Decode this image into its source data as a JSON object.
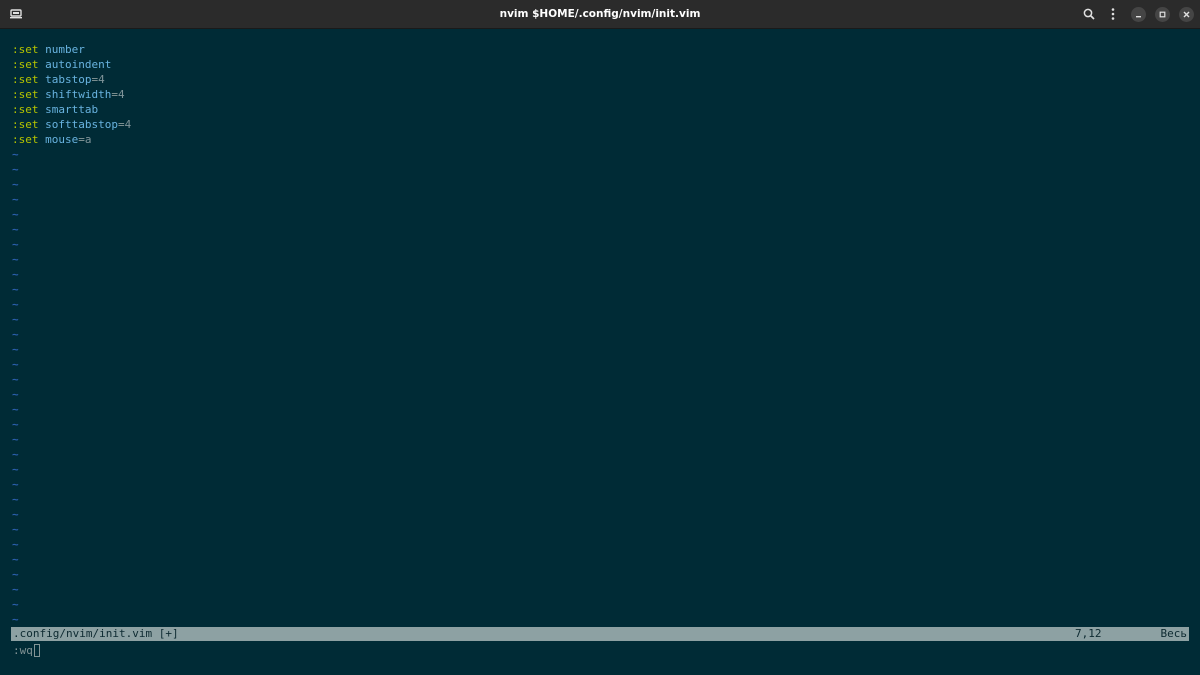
{
  "window": {
    "title": "nvim $HOME/.config/nvim/init.vim"
  },
  "icons": {
    "new_tab": "new-tab-icon",
    "search": "search-icon",
    "menu": "kebab-menu-icon",
    "minimize": "minimize-icon",
    "maximize": "maximize-icon",
    "close": "close-icon"
  },
  "buffer": {
    "lines": [
      {
        "kw": ":set",
        "opt": "number",
        "op": "",
        "val": ""
      },
      {
        "kw": ":set",
        "opt": "autoindent",
        "op": "",
        "val": ""
      },
      {
        "kw": ":set",
        "opt": "tabstop",
        "op": "=",
        "val": "4"
      },
      {
        "kw": ":set",
        "opt": "shiftwidth",
        "op": "=",
        "val": "4"
      },
      {
        "kw": ":set",
        "opt": "smarttab",
        "op": "",
        "val": ""
      },
      {
        "kw": ":set",
        "opt": "softtabstop",
        "op": "=",
        "val": "4"
      },
      {
        "kw": ":set",
        "opt": "mouse",
        "op": "=",
        "val": "a"
      }
    ],
    "empty_marker": "~"
  },
  "statusline": {
    "filename": ".config/nvim/init.vim [+]",
    "position": "7,12",
    "scroll": "Весь"
  },
  "cmdline": {
    "text": ":wq"
  },
  "colors": {
    "background": "#002b36",
    "keyword": "#b5c400",
    "option": "#68b3e0",
    "tilde": "#2a5eab",
    "statusline_bg": "#8da1a3"
  }
}
